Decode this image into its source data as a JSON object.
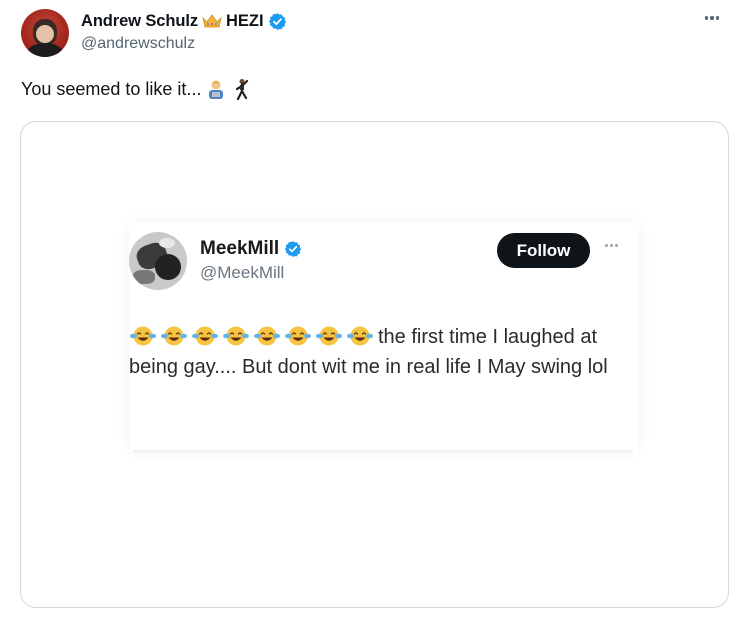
{
  "tweet": {
    "author_name": "Andrew Schulz",
    "name_suffix": "HEZI",
    "handle": "@andrewschulz",
    "text": "You seemed to like it...",
    "emojis": [
      "man-technologist-emoji",
      "dancing-man-emoji"
    ]
  },
  "embedded_tweet": {
    "author_name": "MeekMill",
    "handle": "@MeekMill",
    "follow_label": "Follow",
    "laugh_emoji_count": 8,
    "text": "the first time I laughed at being gay.... But dont wit me in real life I May swing lol"
  },
  "colors": {
    "verified": "#1d9bf0",
    "text_primary": "#0f1419",
    "text_secondary": "#536471",
    "border": "#cfd9de",
    "avatar_bg": "#a3261c"
  }
}
